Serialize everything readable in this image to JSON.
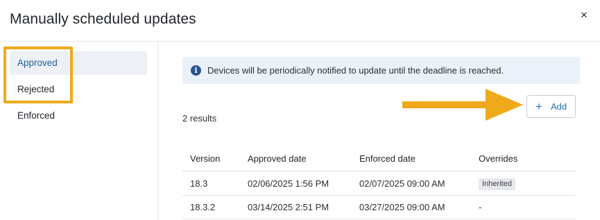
{
  "dialog": {
    "title": "Manually scheduled updates",
    "close_glyph": "×"
  },
  "sidebar": {
    "items": [
      {
        "label": "Approved",
        "active": true
      },
      {
        "label": "Rejected",
        "active": false
      },
      {
        "label": "Enforced",
        "active": false
      }
    ]
  },
  "banner": {
    "icon": "info-icon",
    "icon_glyph": "i",
    "text": "Devices will be periodically notified to update until the deadline is reached."
  },
  "toolbar": {
    "add_glyph": "+",
    "add_label": "Add"
  },
  "results": {
    "text": "2 results"
  },
  "table": {
    "columns": [
      "Version",
      "Approved date",
      "Enforced date",
      "Overrides"
    ],
    "rows": [
      {
        "version": "18.3",
        "approved": "02/06/2025 1:56 PM",
        "enforced": "02/07/2025 09:00 AM",
        "overrides": "Inherited"
      },
      {
        "version": "18.3.2",
        "approved": "03/14/2025 2:51 PM",
        "enforced": "03/27/2025 09:00 AM",
        "overrides": "-"
      }
    ]
  },
  "colors": {
    "accent": "#1d5f9e",
    "annotation": "#f0a91b",
    "banner_bg": "#eaf1f8"
  }
}
